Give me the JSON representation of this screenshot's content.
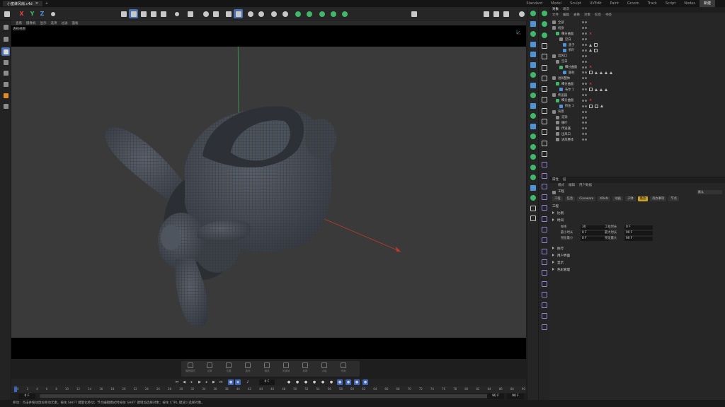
{
  "app": {
    "doc_tab": "小蜜蜂风扇.c4d",
    "doc_tab_close": "×",
    "new_tab": "+",
    "layouts": [
      "Standard",
      "Model",
      "Sculpt",
      "UVEdit",
      "Paint",
      "Groom",
      "Track",
      "Script",
      "Nodes",
      "新建"
    ],
    "active_layout": "新建"
  },
  "toolbar": {
    "axes": [
      "X",
      "Y",
      "Z"
    ]
  },
  "viewport": {
    "menu": [
      "查看",
      "摄像机",
      "显示",
      "选项",
      "过滤",
      "面板"
    ],
    "label": "透视视图",
    "colors": {
      "bg": "#3a3a3a",
      "model": "#4a4f58",
      "wire": "#2a2d33",
      "y_axis": "#2fa84a",
      "x_axis": "#c0392b"
    }
  },
  "anim_tools": [
    "播放模式",
    "记录",
    "位置",
    "旋转",
    "缩放",
    "关键帧",
    "参数",
    "点级",
    "动画"
  ],
  "playbar": {
    "current_frame": "0 F",
    "end_frame": "90 F",
    "min_frame": "0 F",
    "max_frame": "90 F"
  },
  "timeline": {
    "ticks": [
      "0",
      "2",
      "4",
      "6",
      "8",
      "10",
      "12",
      "14",
      "16",
      "18",
      "20",
      "22",
      "24",
      "26",
      "28",
      "30",
      "32",
      "34",
      "36",
      "38",
      "40",
      "42",
      "44",
      "46",
      "48",
      "50",
      "52",
      "54",
      "56",
      "58",
      "60",
      "62",
      "64",
      "66",
      "68",
      "70",
      "72",
      "74",
      "76",
      "78",
      "80",
      "82",
      "84",
      "86",
      "88",
      "90"
    ]
  },
  "status": {
    "text": "移动：点击并拖动鼠标移动元素。按住 SHIFT 键量化移动；节点编辑模式时按住 SHIFT 键增加选择对象；按住 CTRL 键减少选择对象。"
  },
  "objects_panel": {
    "tabs": [
      "对象",
      "场次"
    ],
    "active_tab": "对象",
    "menu": [
      "文件",
      "编辑",
      "查看",
      "对象",
      "标签",
      "书签"
    ],
    "rows": [
      {
        "name": "全部",
        "indent": 0,
        "icon": "null",
        "tags": []
      },
      {
        "name": "机身",
        "indent": 0,
        "icon": "null",
        "tags": []
      },
      {
        "name": "细分曲面",
        "indent": 1,
        "icon": "subd",
        "tags": [
          "x"
        ]
      },
      {
        "name": "空白",
        "indent": 2,
        "icon": "null",
        "tags": []
      },
      {
        "name": "盖子",
        "indent": 3,
        "icon": "poly",
        "tags": [
          "tri",
          "box"
        ]
      },
      {
        "name": "机叶",
        "indent": 3,
        "icon": "poly",
        "tags": [
          "tri",
          "box"
        ]
      },
      {
        "name": "出风口",
        "indent": 0,
        "icon": "null",
        "tags": []
      },
      {
        "name": "空白",
        "indent": 1,
        "icon": "null",
        "tags": []
      },
      {
        "name": "细分曲面",
        "indent": 2,
        "icon": "subd",
        "tags": [
          "x"
        ]
      },
      {
        "name": "圆柱",
        "indent": 3,
        "icon": "poly",
        "tags": [
          "box",
          "tri",
          "tri",
          "tri",
          "tri"
        ]
      },
      {
        "name": "进风整体",
        "indent": 0,
        "icon": "null",
        "tags": []
      },
      {
        "name": "细分曲面",
        "indent": 1,
        "icon": "subd",
        "tags": [
          "x"
        ]
      },
      {
        "name": "布尔 1",
        "indent": 2,
        "icon": "poly",
        "tags": [
          "box",
          "tri",
          "tri",
          "tri"
        ]
      },
      {
        "name": "传送器",
        "indent": 0,
        "icon": "null",
        "tags": []
      },
      {
        "name": "细分曲面",
        "indent": 1,
        "icon": "subd",
        "tags": [
          "x"
        ]
      },
      {
        "name": "挤压 1",
        "indent": 2,
        "icon": "poly",
        "tags": [
          "box",
          "box",
          "tri"
        ]
      },
      {
        "name": "背景",
        "indent": 0,
        "icon": "null",
        "tags": []
      },
      {
        "name": "渲染",
        "indent": 1,
        "icon": "null",
        "tags": []
      },
      {
        "name": "摄叶",
        "indent": 1,
        "icon": "null",
        "tags": []
      },
      {
        "name": "传送器",
        "indent": 1,
        "icon": "null",
        "tags": []
      },
      {
        "name": "出风口",
        "indent": 1,
        "icon": "null",
        "tags": []
      },
      {
        "name": "进风整体",
        "indent": 1,
        "icon": "null",
        "tags": []
      }
    ]
  },
  "attr_panel": {
    "tabs": [
      "属性",
      "层"
    ],
    "active_tab": "属性",
    "menu": [
      "模式",
      "编辑",
      "用户数据"
    ],
    "title": "工程",
    "dropdown": "默认",
    "subtabs": [
      "工程",
      "信息",
      "Cineware",
      "XRefs",
      "动画",
      "子弹",
      "播放",
      "待办事项",
      "节点"
    ],
    "active_subtab": "播放",
    "section_engineering": "工程",
    "sections": [
      "比例",
      "时间",
      "执行",
      "用户界面",
      "显示",
      "色彩管理"
    ],
    "fields_left": [
      {
        "label": "帧率",
        "value": "30"
      },
      {
        "label": "最小时长",
        "value": "0 F"
      },
      {
        "label": "预览最小",
        "value": "0 F"
      }
    ],
    "fields_right": [
      {
        "label": "工程时长",
        "value": "0 F"
      },
      {
        "label": "最大时长",
        "value": "90 F"
      },
      {
        "label": "预览最大",
        "value": "90 F"
      }
    ]
  }
}
